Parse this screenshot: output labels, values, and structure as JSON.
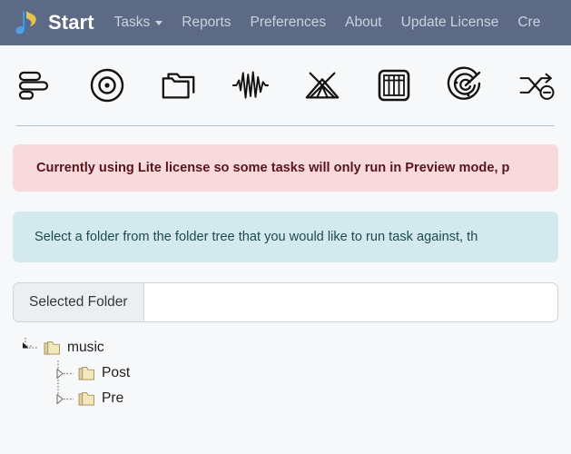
{
  "navbar": {
    "brand": {
      "label": "Start",
      "logo_icon": "music-note-icon"
    },
    "items": [
      {
        "label": "Tasks",
        "has_caret": true
      },
      {
        "label": "Reports",
        "has_caret": false
      },
      {
        "label": "Preferences",
        "has_caret": false
      },
      {
        "label": "About",
        "has_caret": false
      },
      {
        "label": "Update License",
        "has_caret": false
      },
      {
        "label": "Cre",
        "has_caret": false
      }
    ],
    "background_color": "#5c6a85",
    "text_color": "#ccd2dd"
  },
  "toolbar": {
    "buttons": [
      {
        "icon": "bar-list-icon",
        "title": "Sort"
      },
      {
        "icon": "disc-icon",
        "title": "Disc"
      },
      {
        "icon": "folders-icon",
        "title": "Folders"
      },
      {
        "icon": "waveform-icon",
        "title": "Waveform"
      },
      {
        "icon": "tent-icon",
        "title": "Tent"
      },
      {
        "icon": "grid-icon",
        "title": "Grid"
      },
      {
        "icon": "radar-icon",
        "title": "Radar"
      },
      {
        "icon": "shuffle-off-icon",
        "title": "Shuffle Off"
      },
      {
        "icon": "partial-edge-icon",
        "title": "More"
      }
    ]
  },
  "alerts": {
    "warning": {
      "text": "Currently using Lite license so some tasks will only run in Preview mode, p",
      "background_color": "#f8dadd",
      "text_color": "#58151c"
    },
    "info": {
      "text": "Select a folder from the folder tree that you would like to run task against, th",
      "background_color": "#d3e9ed",
      "text_color": "#1b4b52"
    }
  },
  "selected_folder": {
    "label": "Selected Folder",
    "value": "",
    "placeholder": ""
  },
  "folder_tree": {
    "nodes": [
      {
        "label": "music",
        "level": 0,
        "expanded": true
      },
      {
        "label": "Post",
        "level": 1,
        "expanded": false
      },
      {
        "label": "Pre",
        "level": 1,
        "expanded": false
      }
    ]
  }
}
